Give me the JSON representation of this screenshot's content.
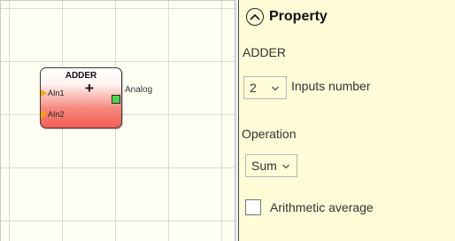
{
  "canvas": {
    "block": {
      "title": "ADDER",
      "operator_symbol": "+",
      "inputs": [
        "AIn1",
        "AIn2"
      ],
      "output_label": "Analog",
      "colors": {
        "input_pin": "#f5a800",
        "output_pin": "#4fd64f",
        "body": "#f25a50"
      }
    }
  },
  "property_panel": {
    "title": "Property",
    "block_name": "ADDER",
    "inputs_number": {
      "value": "2",
      "label": "Inputs number"
    },
    "operation": {
      "label": "Operation",
      "value": "Sum"
    },
    "arithmetic_average": {
      "label": "Arithmetic average",
      "checked": false
    },
    "background_color": "#fffcd8"
  }
}
